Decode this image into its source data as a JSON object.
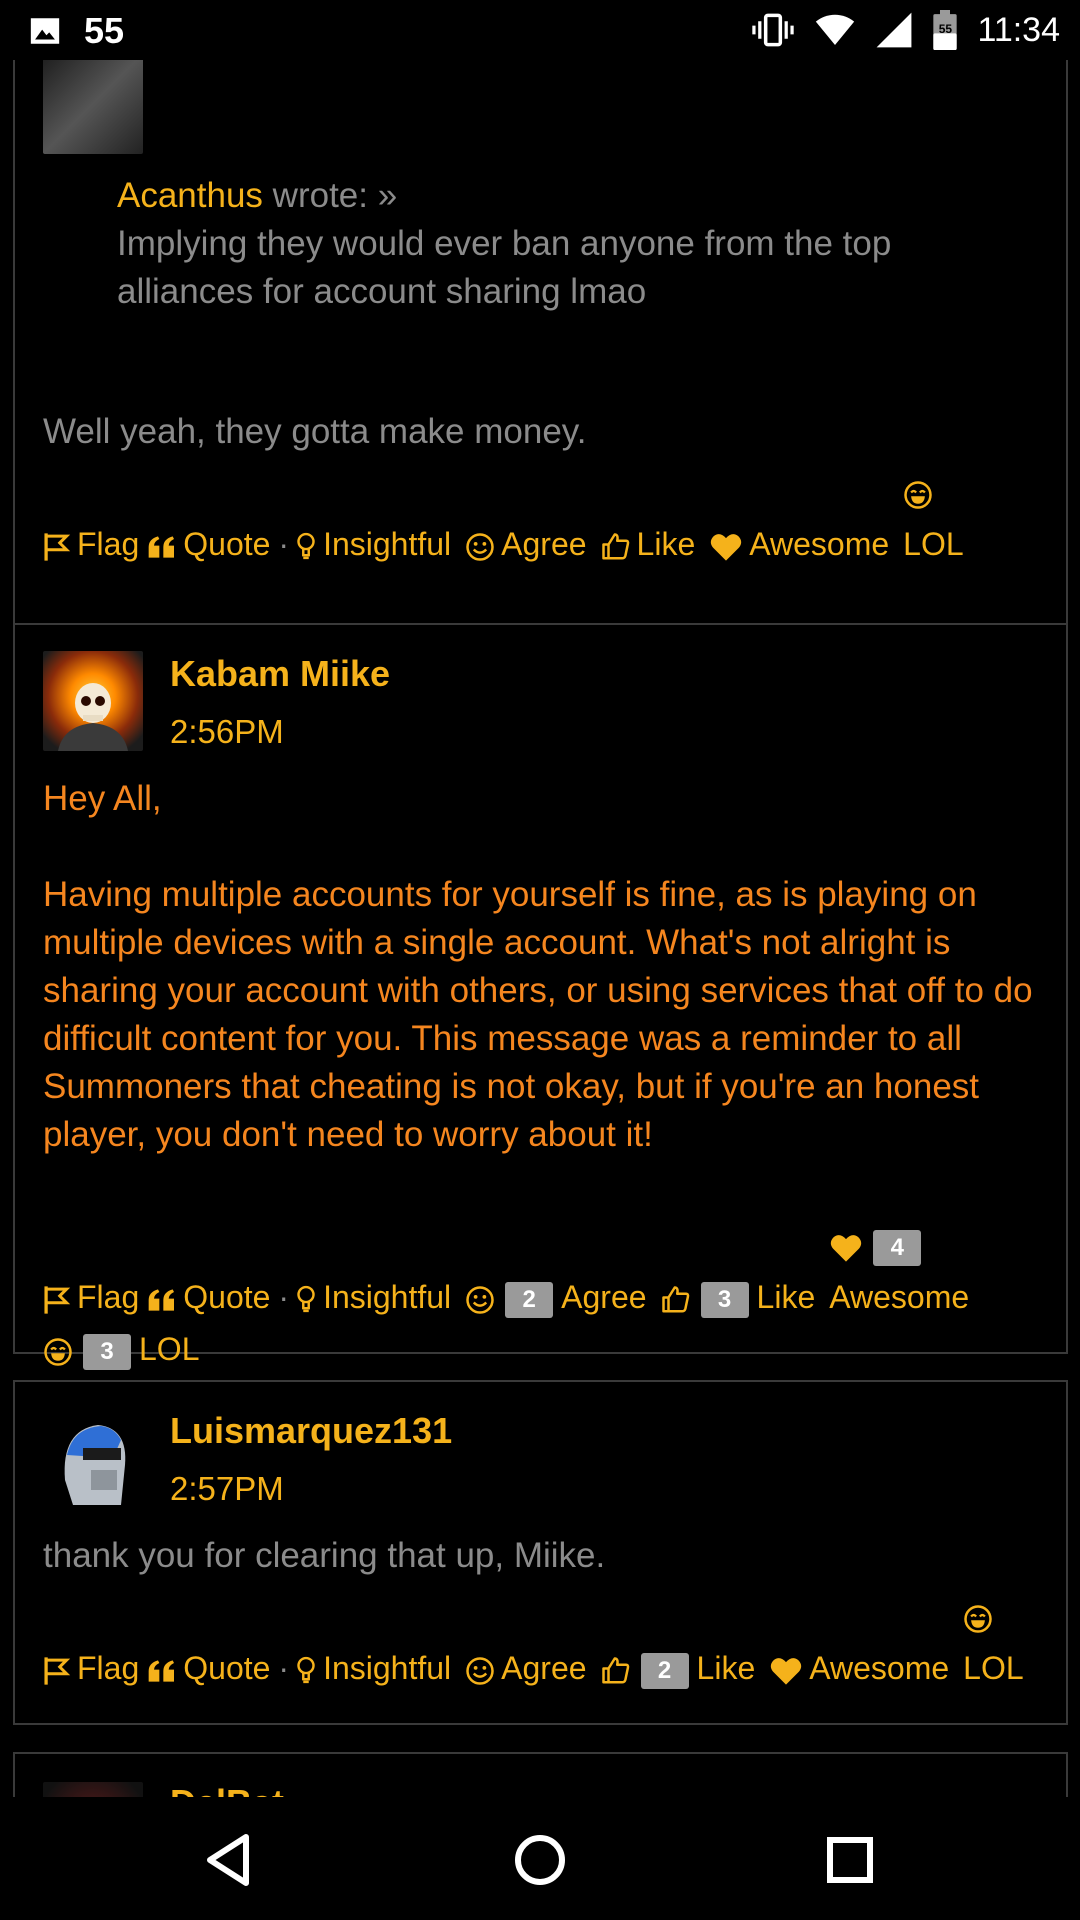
{
  "status_bar": {
    "notification_count": "55",
    "battery_level": "55",
    "time": "11:34",
    "icons": [
      "image-icon",
      "vibrate-icon",
      "wifi-icon",
      "signal-icon",
      "battery-icon"
    ]
  },
  "reaction_labels": {
    "flag": "Flag",
    "quote": "Quote",
    "separator": "·",
    "insightful": "Insightful",
    "agree": "Agree",
    "like": "Like",
    "awesome": "Awesome",
    "lol": "LOL"
  },
  "posts": [
    {
      "quote": {
        "author": "Acanthus",
        "wrote": "wrote: »",
        "text": "Implying they would ever ban anyone from the top alliances for account sharing lmao"
      },
      "body": "Well yeah, they gotta make money."
    },
    {
      "author": "Kabam Miike",
      "time": "2:56PM",
      "body_greeting": "Hey All,",
      "body": "Having multiple accounts for yourself is fine, as is playing on multiple devices with a single account. What's not alright is sharing your account with others, or using services that off to do difficult content for you. This message was a reminder to all Summoners that cheating is not okay, but if you're an honest player, you don't need to worry about it!",
      "counts": {
        "agree": "2",
        "like": "3",
        "awesome": "4",
        "lol": "3"
      }
    },
    {
      "author": "Luismarquez131",
      "time": "2:57PM",
      "body": "thank you for clearing that up, Miike.",
      "counts": {
        "like": "2"
      }
    },
    {
      "author": "DelBat"
    }
  ],
  "colors": {
    "accent": "#f5b21b",
    "staff_text": "#f5861f",
    "muted_text": "#8b8b8b",
    "border": "#3a3a3a",
    "badge": "#9a9a9a"
  }
}
